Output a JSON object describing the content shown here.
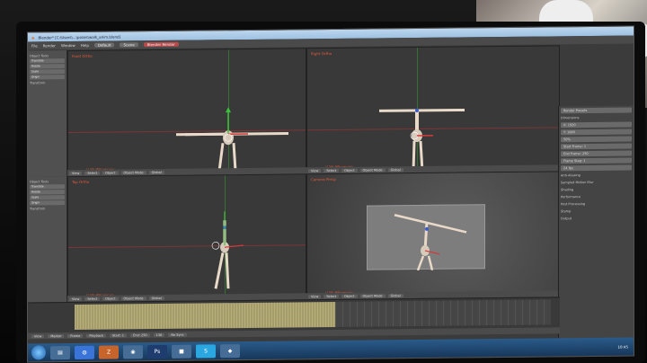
{
  "window": {
    "title": "Blender* [C:\\Users\\...\\poses\\walk_anim.blend]"
  },
  "menubar": {
    "items": [
      "File",
      "Render",
      "Window",
      "Help"
    ],
    "layout_label": "Default",
    "engine_label": "Blender Render",
    "scene_label": "Scene"
  },
  "viewports": [
    {
      "label": "Front Ortho",
      "object": "(130) MPcomcam",
      "mode": "Object Mode"
    },
    {
      "label": "Right Ortho",
      "object": "(130) MPcomcam",
      "mode": "Object Mode"
    },
    {
      "label": "Top Ortho",
      "object": "(130) MPcomcam",
      "mode": "Object Mode"
    },
    {
      "label": "Camera Persp",
      "object": "(130) MPcomcam",
      "mode": "Object Mode"
    }
  ],
  "viewheader": {
    "view": "View",
    "select": "Select",
    "object": "Object",
    "mode": "Object Mode",
    "pivot": "Global"
  },
  "shelf": {
    "title": "Object Tools",
    "buttons": [
      "Translate",
      "Rotate",
      "Scale",
      "Origin"
    ],
    "section": "Transform"
  },
  "properties": {
    "render_presets": "Render Presets",
    "dimensions": "Dimensions",
    "resolution_x": "X: 1920",
    "resolution_y": "Y: 1080",
    "percent": "50%",
    "start_frame": "Start Frame: 1",
    "end_frame": "End Frame: 250",
    "frame_step": "Frame Step: 1",
    "fps": "24 fps",
    "sections": [
      "Anti-Aliasing",
      "Sampled Motion Blur",
      "Shading",
      "Performance",
      "Post Processing",
      "Stamp",
      "Output"
    ]
  },
  "timeline": {
    "menu": [
      "View",
      "Marker",
      "Frame",
      "Playback"
    ],
    "start": "Start: 1",
    "end": "End: 250",
    "current": "130",
    "sync": "No Sync"
  },
  "taskbar": {
    "clock": "10:45"
  },
  "colors": {
    "titlebar": "#bcd6ee",
    "viewport": "#393939",
    "accent": "#e85a3a"
  }
}
